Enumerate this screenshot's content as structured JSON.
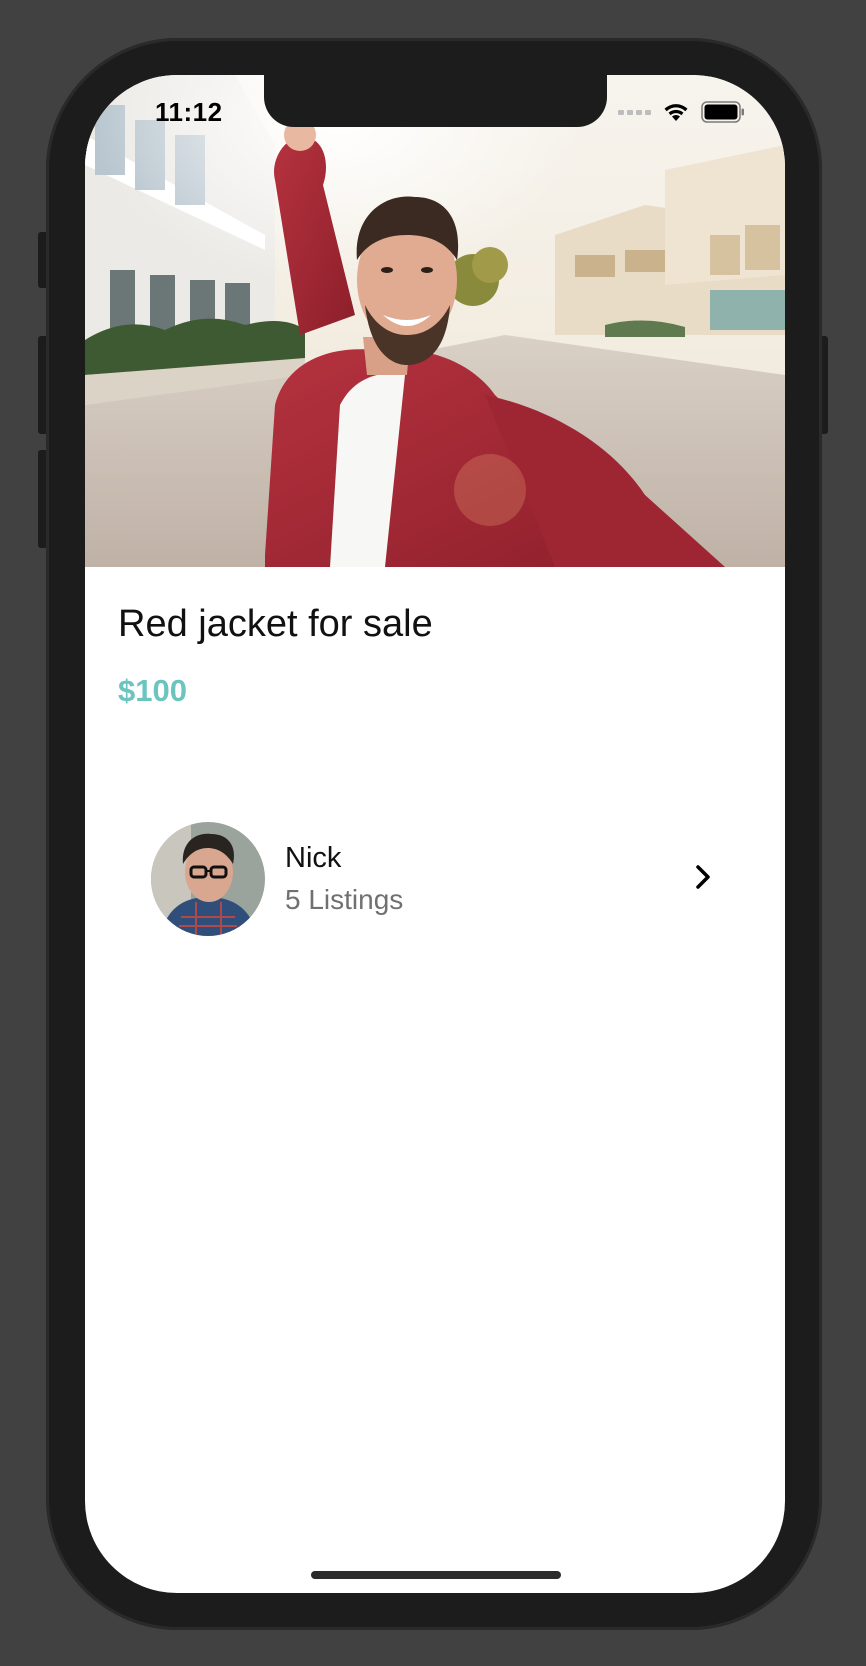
{
  "status_bar": {
    "time": "11:12"
  },
  "listing": {
    "title": "Red jacket for sale",
    "price": "$100",
    "price_color": "#6cc4be"
  },
  "seller": {
    "name": "Nick",
    "listings": "5 Listings"
  },
  "icons": {
    "wifi": "wifi-icon",
    "battery": "battery-icon",
    "chevron": "chevron-right-icon"
  }
}
